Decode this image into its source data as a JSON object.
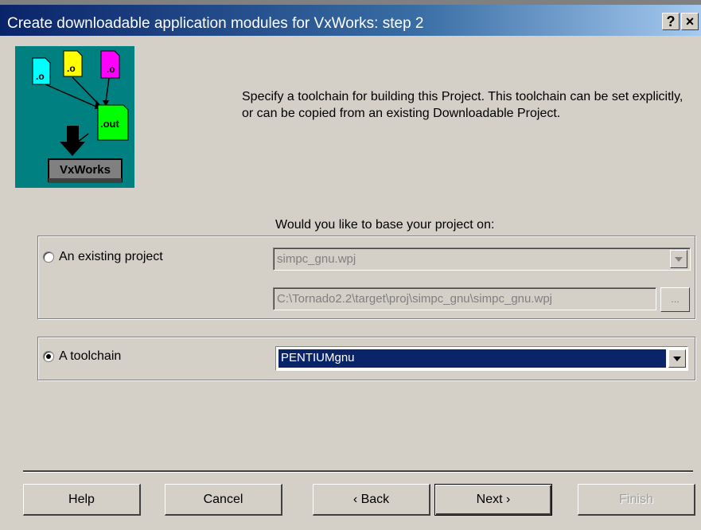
{
  "window": {
    "title": "Create downloadable application modules for VxWorks:  step 2",
    "help_glyph": "?",
    "close_glyph": "×"
  },
  "illustration": {
    "obj_labels": [
      ".o",
      ".o",
      ".o"
    ],
    "out_label": ".out",
    "target_label": "VxWorks"
  },
  "intro_text": "Specify a toolchain for building this Project. This toolchain can be set explicitly, or can be copied from an existing Downloadable Project.",
  "question": "Would you like to base your project on:",
  "existing_project": {
    "label": "An existing project",
    "selected": false,
    "project_value": "simpc_gnu.wpj",
    "path_value": "C:\\Tornado2.2\\target\\proj\\simpc_gnu\\simpc_gnu.wpj",
    "browse_label": "..."
  },
  "toolchain": {
    "label": "A toolchain",
    "selected": true,
    "value": "PENTIUMgnu"
  },
  "buttons": {
    "help": "Help",
    "cancel": "Cancel",
    "back": "‹ Back",
    "next": "Next ›",
    "finish": "Finish"
  }
}
